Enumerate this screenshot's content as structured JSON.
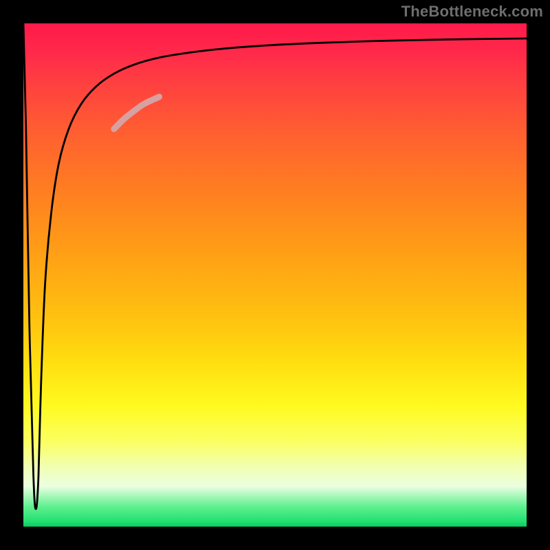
{
  "watermark": "TheBottleneck.com",
  "chart_data": {
    "type": "line",
    "title": "",
    "xlabel": "",
    "ylabel": "",
    "xlim": [
      0,
      100
    ],
    "ylim": [
      0,
      100
    ],
    "axis_ticks": {
      "x": [],
      "y": []
    },
    "grid": false,
    "legend": false,
    "gradient_stops": [
      {
        "pos": 0.0,
        "color": "#ff1a4a"
      },
      {
        "pos": 0.12,
        "color": "#ff4040"
      },
      {
        "pos": 0.34,
        "color": "#ff8020"
      },
      {
        "pos": 0.58,
        "color": "#ffc010"
      },
      {
        "pos": 0.76,
        "color": "#fffa20"
      },
      {
        "pos": 0.92,
        "color": "#eaffe0"
      },
      {
        "pos": 0.99,
        "color": "#20e070"
      },
      {
        "pos": 1.0,
        "color": "#0cc860"
      }
    ],
    "series": [
      {
        "name": "curve",
        "stroke": "#000000",
        "stroke_width": 2.8,
        "x": [
          0.0,
          0.5,
          1.2,
          2.0,
          2.5,
          3.0,
          3.5,
          4.3,
          5.5,
          7.0,
          9.0,
          11.5,
          14.5,
          18.0,
          22.0,
          27.0,
          33.0,
          40.0,
          48.0,
          58.0,
          70.0,
          84.0,
          100.0
        ],
        "y": [
          100.0,
          80.0,
          40.0,
          10.0,
          3.5,
          10.0,
          28.0,
          48.0,
          62.0,
          72.0,
          79.0,
          84.0,
          87.5,
          90.0,
          91.8,
          93.2,
          94.2,
          95.0,
          95.6,
          96.1,
          96.5,
          96.8,
          97.0
        ]
      },
      {
        "name": "highlight-segment",
        "stroke": "#d8a0a0",
        "stroke_width": 9,
        "x": [
          18.0,
          20.0,
          22.0,
          24.0,
          27.0
        ],
        "y": [
          79.0,
          81.0,
          82.6,
          84.0,
          85.4
        ]
      }
    ],
    "notes": "x and y in 0..100 domain units; y=0 is chart bottom, y=100 is chart top. The black thick frame is the axes border; no tick labels are rendered."
  }
}
